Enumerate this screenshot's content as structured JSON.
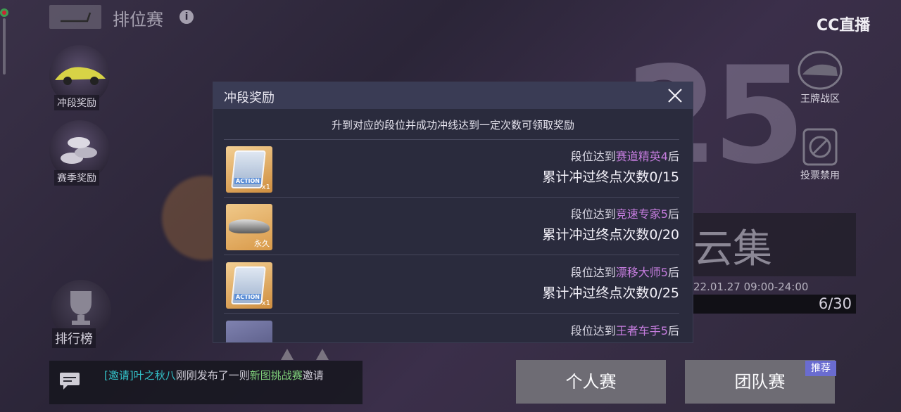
{
  "top_bar": {
    "title": "排位赛",
    "info_icon": "info-icon",
    "back_icon": "back-icon"
  },
  "watermark": {
    "text": "CC直播"
  },
  "side_menu": {
    "rush_rewards": "冲段奖励",
    "season_rewards": "赛季奖励",
    "leaderboard": "排行榜",
    "ace_zone": "王牌战区",
    "vote_ban": "投票禁用"
  },
  "background": {
    "rank_number": "25"
  },
  "modal": {
    "title": "冲段奖励",
    "subtitle": "升到对应的段位并成功冲线达到一定次数可领取奖励",
    "rows": [
      {
        "prefix": "段位达到",
        "rank": "赛道精英4",
        "suffix": "后",
        "progress": "累计冲过终点次数0/15",
        "reward_label": "ACTION",
        "reward_qty": "x1"
      },
      {
        "prefix": "段位达到",
        "rank": "竞速专家5",
        "suffix": "后",
        "progress": "累计冲过终点次数0/20",
        "reward_label": "",
        "reward_qty": "永久"
      },
      {
        "prefix": "段位达到",
        "rank": "漂移大师5",
        "suffix": "后",
        "progress": "累计冲过终点次数0/25",
        "reward_label": "ACTION",
        "reward_qty": "x1"
      },
      {
        "prefix": "段位达到",
        "rank": "王者车手5",
        "suffix": "后",
        "progress": "",
        "reward_label": "",
        "reward_qty": ""
      }
    ]
  },
  "event": {
    "title": "云集",
    "date": "22.01.27 09:00-24:00",
    "count": "6/30"
  },
  "chat": {
    "tag": "[邀请]",
    "user": "叶之秋八",
    "text1": "刚刚发布了一则",
    "link": "新图挑战赛",
    "text2": "邀请"
  },
  "modes": {
    "solo": "个人赛",
    "team": "团队赛",
    "recommend": "推荐"
  },
  "colors": {
    "highlight": "#c67ddf",
    "cyan": "#33c1c8",
    "badge": "#6a6cd0"
  }
}
